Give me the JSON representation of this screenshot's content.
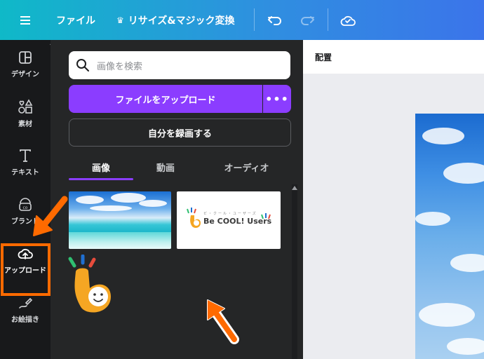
{
  "topbar": {
    "menu_icon": "hamburger-icon",
    "file_label": "ファイル",
    "resize_label": "リサイズ&マジック変換",
    "resize_icon": "crown-icon",
    "undo_icon": "undo-icon",
    "redo_icon": "redo-icon",
    "save_status_icon": "cloud-check-icon"
  },
  "rail": {
    "items": [
      {
        "label": "デザイン",
        "icon": "design-icon"
      },
      {
        "label": "素材",
        "icon": "elements-icon"
      },
      {
        "label": "テキスト",
        "icon": "text-icon"
      },
      {
        "label": "ブランド",
        "icon": "brand-icon"
      },
      {
        "label": "アップロード",
        "icon": "upload-cloud-icon",
        "active": true
      },
      {
        "label": "お絵描き",
        "icon": "draw-icon"
      }
    ]
  },
  "panel": {
    "search_placeholder": "画像を検索",
    "upload_button": "ファイルをアップロード",
    "more_button": "•••",
    "record_button": "自分を録画する",
    "tabs": [
      "画像",
      "動画",
      "オーディオ"
    ],
    "active_tab": "画像",
    "thumbnails": [
      {
        "kind": "photo",
        "subject": "beach"
      },
      {
        "kind": "logo",
        "text": "Be COOL! Users",
        "small_text": "ビ・クール・ユーザーズ"
      },
      {
        "kind": "mascot"
      }
    ]
  },
  "canvas": {
    "header_label": "配置"
  },
  "colors": {
    "accent": "#8b3dff",
    "highlight": "#ff6a00",
    "rail_bg": "#18191b",
    "panel_bg": "#252627"
  }
}
